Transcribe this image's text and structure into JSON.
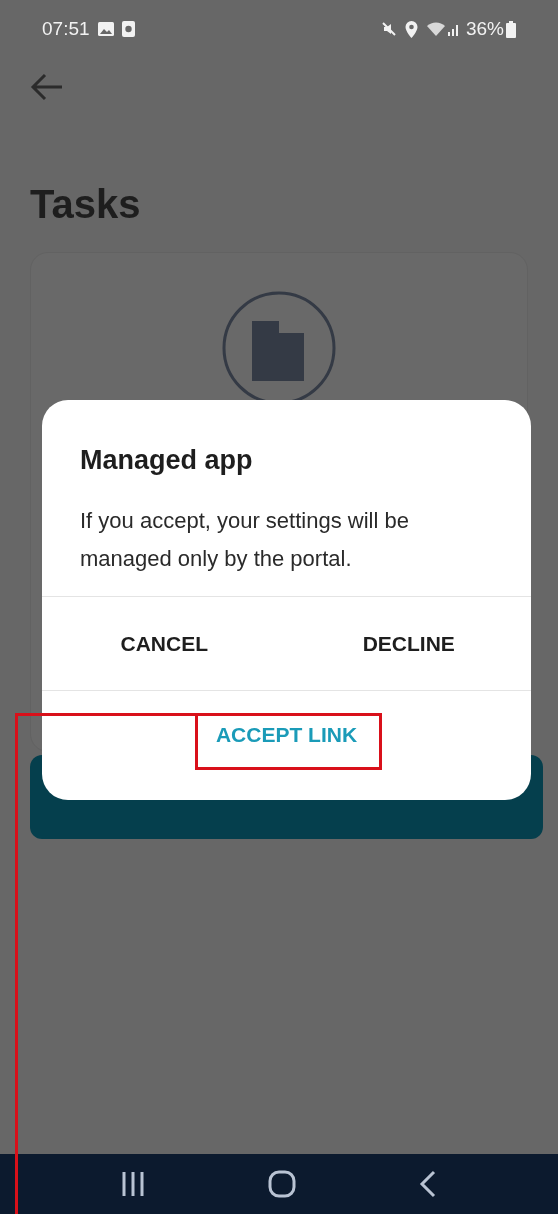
{
  "status_bar": {
    "time": "07:51",
    "battery": "36%"
  },
  "page": {
    "title": "Tasks"
  },
  "dialog": {
    "title": "Managed app",
    "message": "If you accept, your settings will be managed only by the portal.",
    "buttons": [
      {
        "label": "CANCEL",
        "kind": "plain"
      },
      {
        "label": "DECLINE",
        "kind": "plain"
      },
      {
        "label": "ACCEPT LINK",
        "kind": "primary"
      }
    ]
  }
}
